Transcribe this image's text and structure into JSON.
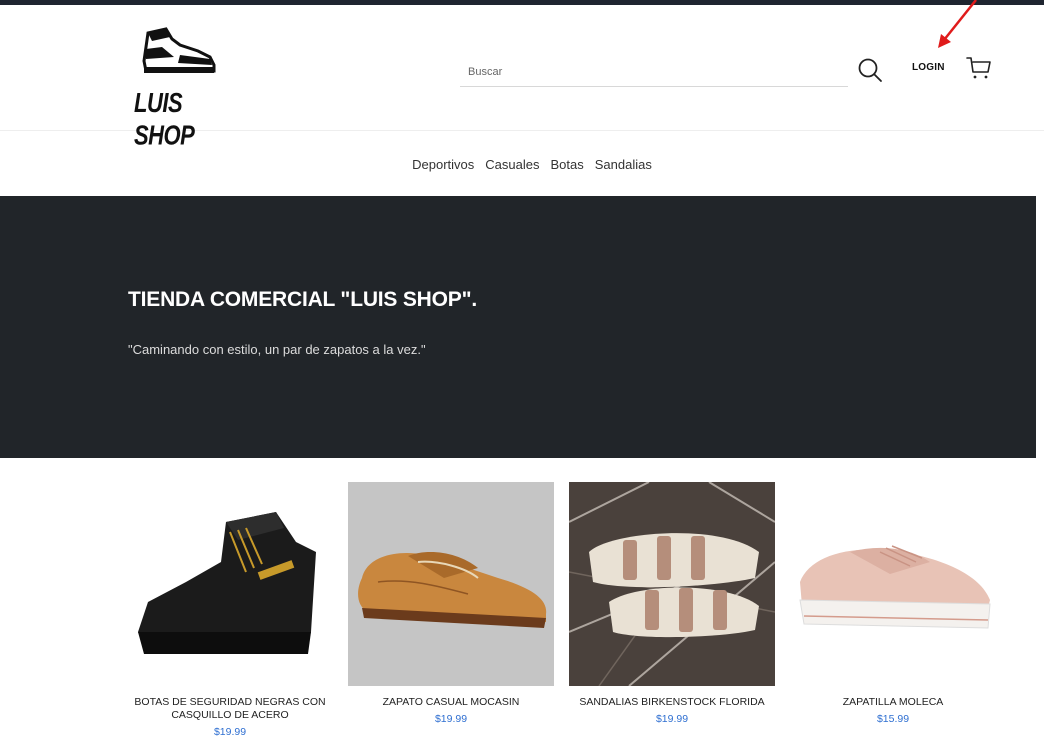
{
  "header": {
    "brand": "LUIS SHOP",
    "search_placeholder": "Buscar",
    "login_label": "LOGIN"
  },
  "nav": {
    "items": [
      "Deportivos",
      "Casuales",
      "Botas",
      "Sandalias"
    ]
  },
  "hero": {
    "title": "TIENDA COMERCIAL \"LUIS SHOP\".",
    "subtitle": "\"Caminando con estilo, un par de zapatos a la vez.\""
  },
  "products": [
    {
      "name": "BOTAS DE SEGURIDAD NEGRAS CON CASQUILLO DE ACERO",
      "price": "$19.99"
    },
    {
      "name": "ZAPATO CASUAL MOCASIN",
      "price": "$19.99"
    },
    {
      "name": "SANDALIAS BIRKENSTOCK FLORIDA",
      "price": "$19.99"
    },
    {
      "name": "ZAPATILLA MOLECA",
      "price": "$15.99"
    }
  ],
  "colors": {
    "hero_bg": "#212529",
    "price": "#2f6fd1",
    "annotation_arrow": "#e01b1b"
  },
  "icons": [
    "sneaker-logo",
    "search-icon",
    "cart-icon",
    "annotation-arrow"
  ]
}
